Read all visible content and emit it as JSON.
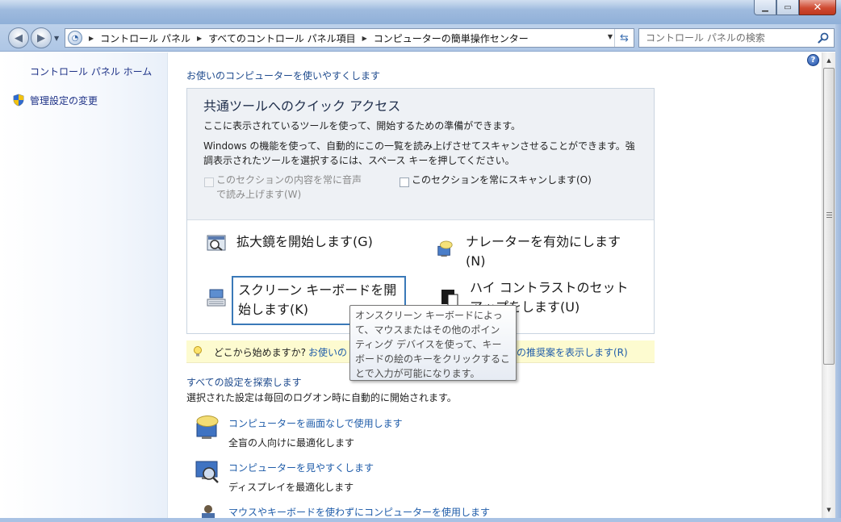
{
  "window": {
    "title": "",
    "close_glyph": "✕",
    "minimize_glyph": "▁",
    "maximize_glyph": "▭"
  },
  "navbar": {
    "breadcrumbs": [
      "コントロール パネル",
      "すべてのコントロール パネル項目",
      "コンピューターの簡単操作センター"
    ],
    "search_placeholder": "コントロール パネルの検索"
  },
  "sidebar": {
    "home_label": "コントロール パネル ホーム",
    "admin_label": "管理設定の変更"
  },
  "main": {
    "section_title": "お使いのコンピューターを使いやすくします",
    "quick_access": {
      "title": "共通ツールへのクイック アクセス",
      "desc1": "ここに表示されているツールを使って、開始するための準備ができます。",
      "desc2_line1": "Windows の機能を使って、自動的にこの一覧を読み上げさせてスキャンさせることができます。強",
      "desc2_line2": "調表示されたツールを選択するには、スペース キーを押してください。",
      "checkbox_read_line1": "このセクションの内容を常に音声",
      "checkbox_read_line2": "で読み上げます(W)",
      "checkbox_scan": "このセクションを常にスキャンします(O)",
      "tools": {
        "magnifier": "拡大鏡を開始します(G)",
        "narrator_line1": "ナレーターを有効にします",
        "narrator_line2": "(N)",
        "osk_line1": "スクリーン キーボードを開",
        "osk_line2": "始します(K)",
        "contrast_line1": "ハイ コントラストのセット",
        "contrast_line2": "アップをします(U)"
      }
    },
    "tip": {
      "prefix": "どこから始めますか?",
      "link_start": "お使いの",
      "link_end": "の推奨案を表示します(R)"
    },
    "tooltip": [
      "オンスクリーン キーボードによっ",
      "て、マウスまたはその他のポイン",
      "ティング デバイスを使って、キー",
      "ボードの絵のキーをクリックするこ",
      "とで入力が可能になります。"
    ],
    "explore": {
      "title": "すべての設定を探索します",
      "subtitle": "選択された設定は毎回のログオン時に自動的に開始されます。"
    },
    "settings": [
      {
        "title": "コンピューターを画面なしで使用します",
        "desc": "全盲の人向けに最適化します"
      },
      {
        "title": "コンピューターを見やすくします",
        "desc": "ディスプレイを最適化します"
      },
      {
        "title": "マウスやキーボードを使わずにコンピューターを使用します",
        "desc": ""
      }
    ]
  },
  "colors": {
    "link": "#1f5ca9",
    "sidebar_link": "#1e3287",
    "focus_border": "#3a79b8",
    "tip_background": "#fdfbd0"
  }
}
